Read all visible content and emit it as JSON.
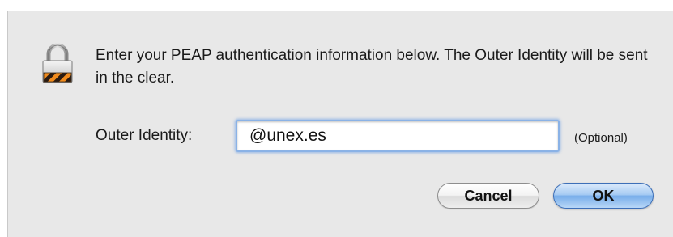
{
  "dialog": {
    "icon": "padlock-icon",
    "message": "Enter your PEAP authentication information below. The Outer Identity will be sent in the clear.",
    "field": {
      "label": "Outer Identity:",
      "value": "@unex.es",
      "hint": "(Optional)"
    },
    "buttons": {
      "cancel_label": "Cancel",
      "ok_label": "OK"
    }
  },
  "colors": {
    "dialog_background": "#e8e8e8",
    "focus_ring": "#8ab2e6",
    "default_button": "#78aeea"
  }
}
